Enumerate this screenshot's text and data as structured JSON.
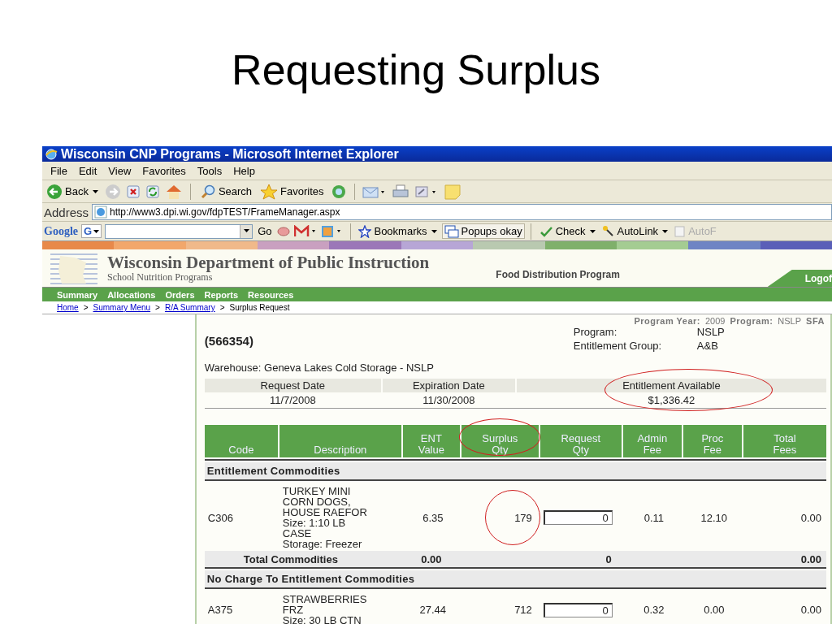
{
  "slide_title": "Requesting Surplus",
  "window": {
    "title": "Wisconsin CNP Programs - Microsoft Internet Explorer"
  },
  "menu": [
    "File",
    "Edit",
    "View",
    "Favorites",
    "Tools",
    "Help"
  ],
  "toolbar": {
    "back": "Back",
    "search": "Search",
    "favorites": "Favorites"
  },
  "address": {
    "label": "Address",
    "url": "http://www3.dpi.wi.gov/fdpTEST/FrameManager.aspx"
  },
  "google_bar": {
    "logo": "Google",
    "g": "G",
    "go": "Go",
    "bookmarks": "Bookmarks",
    "popups": "Popups okay",
    "check": "Check",
    "autolink": "AutoLink",
    "autofill": "AutoF"
  },
  "site": {
    "title": "Wisconsin Department of Public Instruction",
    "subtitle": "School Nutrition Programs",
    "program": "Food Distribution Program",
    "logoff": "Logof"
  },
  "nav": [
    "Summary",
    "Allocations",
    "Orders",
    "Reports",
    "Resources"
  ],
  "breadcrumb": [
    {
      "label": "Home",
      "link": true
    },
    {
      "label": "Summary Menu",
      "link": true
    },
    {
      "label": "R/A Summary",
      "link": true
    },
    {
      "label": "Surplus Request",
      "link": false
    }
  ],
  "info_line": [
    {
      "label": "Program Year:",
      "value": "2009"
    },
    {
      "label": "Program:",
      "value": "NSLP"
    },
    {
      "label": "SFA"
    }
  ],
  "breadcrumb_separator": ">",
  "sfa_id": "(566354)",
  "program": [
    {
      "label": "Program:",
      "value": "NSLP"
    },
    {
      "label": "Entitlement Group:",
      "value": "A&B"
    }
  ],
  "warehouse": "Warehouse: Geneva Lakes Cold Storage - NSLP",
  "dates": [
    {
      "label": "Request Date",
      "value": "11/7/2008",
      "circled": false
    },
    {
      "label": "Expiration Date",
      "value": "11/30/2008",
      "circled": false
    },
    {
      "label": "Entitlement Available",
      "value": "$1,336.42",
      "circled": true
    }
  ],
  "columns": [
    {
      "lines": [
        "Code"
      ],
      "circled": false
    },
    {
      "lines": [
        "Description"
      ],
      "circled": false
    },
    {
      "lines": [
        "ENT",
        "Value"
      ],
      "circled": false
    },
    {
      "lines": [
        "Surplus",
        "Qty"
      ],
      "circled": true
    },
    {
      "lines": [
        "Request",
        "Qty"
      ],
      "circled": false
    },
    {
      "lines": [
        "Admin",
        "Fee"
      ],
      "circled": false
    },
    {
      "lines": [
        "Proc",
        "Fee"
      ],
      "circled": false
    },
    {
      "lines": [
        "Total",
        "Fees"
      ],
      "circled": false
    }
  ],
  "sections": [
    {
      "title": "Entitlement Commodities",
      "rows": [
        {
          "code": "C306",
          "description": [
            "TURKEY MINI",
            "CORN DOGS,",
            "HOUSE RAEFOR",
            "Size:  1:10 LB",
            "CASE",
            "Storage:  Freezer"
          ],
          "ent_value": "6.35",
          "surplus_qty": "179",
          "surplus_circled": true,
          "request_qty": "0",
          "admin_fee": "0.11",
          "proc_fee": "12.10",
          "total_fees": "0.00"
        }
      ],
      "total": {
        "label": "Total Commodities",
        "ent_value": "0.00",
        "request_qty": "0",
        "total_fees": "0.00"
      }
    },
    {
      "title": "No Charge To Entitlement Commodities",
      "rows": [
        {
          "code": "A375",
          "description": [
            "STRAWBERRIES",
            "FRZ",
            "Size:  30 LB CTN"
          ],
          "ent_value": "27.44",
          "surplus_qty": "712",
          "surplus_circled": false,
          "request_qty": "0",
          "admin_fee": "0.32",
          "proc_fee": "0.00",
          "total_fees": "0.00"
        }
      ]
    }
  ]
}
